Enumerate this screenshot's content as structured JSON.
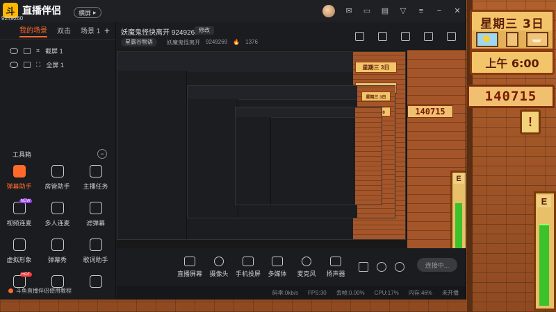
{
  "app": {
    "brand": "直播伴侣",
    "logo_glyph": "斗",
    "room_id": "9249260",
    "mode_label": "横屏"
  },
  "game": {
    "day": "星期三 3日",
    "time": "上午 6:00",
    "money": "140715",
    "journal_mark": "!",
    "energy_label": "E",
    "energy_level": 0.85
  },
  "scenes": {
    "tabs": [
      "我的场景",
      "双击",
      "场景 1"
    ],
    "active_tab": 0,
    "add_label": "+",
    "sources": [
      {
        "label": "截屏 1"
      },
      {
        "label": "全屏 1"
      }
    ]
  },
  "toolbox": {
    "title": "工具箱",
    "toggle": "−",
    "items": [
      {
        "label": "弹幕助手",
        "active": true,
        "badge": ""
      },
      {
        "label": "房管助手",
        "active": false,
        "badge": ""
      },
      {
        "label": "主播任务",
        "active": false,
        "badge": ""
      },
      {
        "label": "视频连麦",
        "active": false,
        "badge": "NEW"
      },
      {
        "label": "多人连麦",
        "active": false,
        "badge": ""
      },
      {
        "label": "滤弹幕",
        "active": false,
        "badge": ""
      },
      {
        "label": "虚拟形象",
        "active": false,
        "badge": ""
      },
      {
        "label": "弹幕秀",
        "active": false,
        "badge": ""
      },
      {
        "label": "歌词助手",
        "active": false,
        "badge": ""
      },
      {
        "label": "",
        "active": false,
        "badge": "HOT"
      },
      {
        "label": "",
        "active": false,
        "badge": ""
      },
      {
        "label": "",
        "active": false,
        "badge": ""
      }
    ],
    "tutorial": "斗鱼直播伴侣使用教程"
  },
  "room": {
    "title": "妖魔鬼怪快离开 9249269",
    "edit_label": "修改",
    "category": "星露谷物语",
    "streamer": "妖魔鬼怪离开",
    "room_no": "9249269",
    "heat": "1376"
  },
  "toolbar": {
    "buttons": [
      {
        "label": "直播屏幕",
        "icon": "screen-icon"
      },
      {
        "label": "摄像头",
        "icon": "camera-icon"
      },
      {
        "label": "手机投屏",
        "icon": "phone-icon"
      },
      {
        "label": "多媒体",
        "icon": "media-icon"
      },
      {
        "label": "麦克风",
        "icon": "mic-icon"
      },
      {
        "label": "扬声器",
        "icon": "speaker-icon"
      }
    ],
    "live_button": "连接中..."
  },
  "status": {
    "bitrate": "码率:0kb/s",
    "fps": "FPS:30",
    "dropped": "丢帧:0.00%",
    "cpu": "CPU:17%",
    "memory": "内存:46%",
    "mode": "未开播"
  },
  "nested": {
    "day": "星期三 3日",
    "time": "上午 6:00",
    "money": "140715"
  }
}
